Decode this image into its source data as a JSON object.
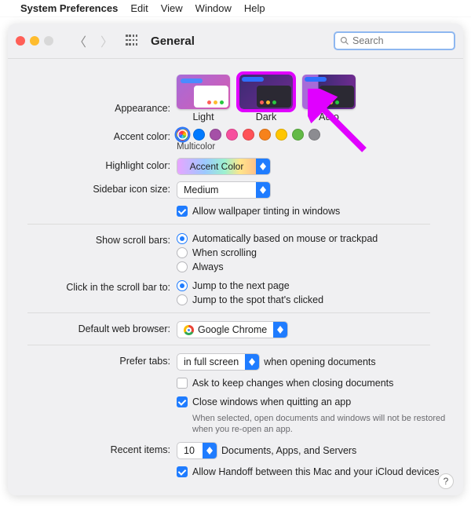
{
  "menubar": {
    "apple": "",
    "app": "System Preferences",
    "items": [
      "Edit",
      "View",
      "Window",
      "Help"
    ]
  },
  "window": {
    "title": "General",
    "search_placeholder": "Search"
  },
  "appearance": {
    "label": "Appearance:",
    "options": [
      "Light",
      "Dark",
      "Auto"
    ],
    "selected": "Dark"
  },
  "accent": {
    "label": "Accent color:",
    "colors": [
      "multicolor",
      "#007aff",
      "#a550a7",
      "#f74f9e",
      "#ff5257",
      "#f7821b",
      "#ffc600",
      "#62ba46",
      "#8c8c91"
    ],
    "selected_index": 0,
    "caption": "Multicolor"
  },
  "highlight": {
    "label": "Highlight color:",
    "value": "Accent Color"
  },
  "sidebar_size": {
    "label": "Sidebar icon size:",
    "value": "Medium"
  },
  "wallpaper_tint": {
    "label": "Allow wallpaper tinting in windows",
    "checked": true
  },
  "scroll": {
    "label": "Show scroll bars:",
    "options": [
      "Automatically based on mouse or trackpad",
      "When scrolling",
      "Always"
    ],
    "selected_index": 0
  },
  "click_scroll": {
    "label": "Click in the scroll bar to:",
    "options": [
      "Jump to the next page",
      "Jump to the spot that's clicked"
    ],
    "selected_index": 0
  },
  "browser": {
    "label": "Default web browser:",
    "value": "Google Chrome"
  },
  "tabs": {
    "label": "Prefer tabs:",
    "value": "in full screen",
    "suffix": "when opening documents"
  },
  "ask_keep": {
    "label": "Ask to keep changes when closing documents",
    "checked": false
  },
  "close_windows": {
    "label": "Close windows when quitting an app",
    "checked": true,
    "hint": "When selected, open documents and windows will not be restored when you re-open an app."
  },
  "recent": {
    "label": "Recent items:",
    "value": "10",
    "suffix": "Documents, Apps, and Servers"
  },
  "handoff": {
    "label": "Allow Handoff between this Mac and your iCloud devices",
    "checked": true
  },
  "help": "?"
}
